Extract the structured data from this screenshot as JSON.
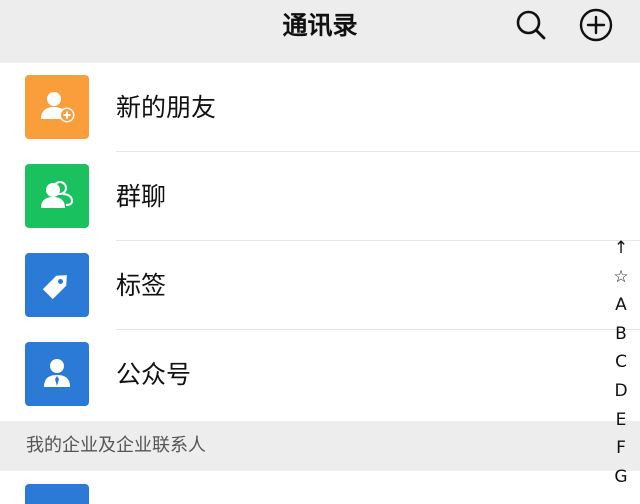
{
  "header": {
    "title": "通讯录",
    "search_icon": "search-icon",
    "add_icon": "add-circle-icon"
  },
  "menu_items": [
    {
      "label": "新的朋友",
      "icon": "add-friend-icon",
      "color": "#fa9d3b"
    },
    {
      "label": "群聊",
      "icon": "group-chat-icon",
      "color": "#19c15f"
    },
    {
      "label": "标签",
      "icon": "tag-icon",
      "color": "#2b7bd6"
    },
    {
      "label": "公众号",
      "icon": "official-account-icon",
      "color": "#2b7bd6"
    }
  ],
  "section": {
    "title": "我的企业及企业联系人"
  },
  "index_bar": [
    "↑",
    "☆",
    "A",
    "B",
    "C",
    "D",
    "E",
    "F",
    "G"
  ]
}
